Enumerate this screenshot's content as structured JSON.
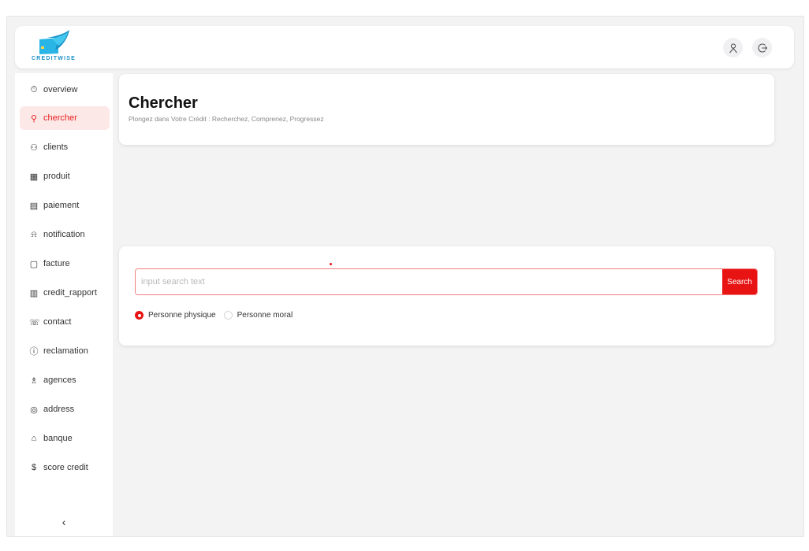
{
  "brand": {
    "name": "CREDITWISE"
  },
  "topbar": {
    "user_icon": "user-icon",
    "logout_icon": "logout-icon"
  },
  "sidebar": {
    "items": [
      {
        "label": "overview",
        "icon": "⏱"
      },
      {
        "label": "chercher",
        "icon": "⚲"
      },
      {
        "label": "clients",
        "icon": "⚇"
      },
      {
        "label": "produit",
        "icon": "▦"
      },
      {
        "label": "paiement",
        "icon": "▤"
      },
      {
        "label": "notification",
        "icon": "⍾"
      },
      {
        "label": "facture",
        "icon": "▢"
      },
      {
        "label": "credit_rapport",
        "icon": "▥"
      },
      {
        "label": "contact",
        "icon": "☏"
      },
      {
        "label": "reclamation",
        "icon": "ⓘ"
      },
      {
        "label": "agences",
        "icon": "♗"
      },
      {
        "label": "address",
        "icon": "◎"
      },
      {
        "label": "banque",
        "icon": "⌂"
      },
      {
        "label": "score credit",
        "icon": "$"
      }
    ],
    "active": "chercher",
    "collapse_glyph": "‹"
  },
  "header_card": {
    "title": "Chercher",
    "subtitle": "Plongez dans Votre Crédit : Recherchez, Comprenez, Progressez"
  },
  "search": {
    "placeholder": "input search text",
    "value": "",
    "button_label": "Search",
    "options": [
      {
        "label": "Personne physique",
        "selected": true
      },
      {
        "label": "Personne moral",
        "selected": false
      }
    ]
  },
  "colors": {
    "accent": "#e81414",
    "brand_blue": "#1a92c7",
    "active_bg": "#fde8e8"
  }
}
